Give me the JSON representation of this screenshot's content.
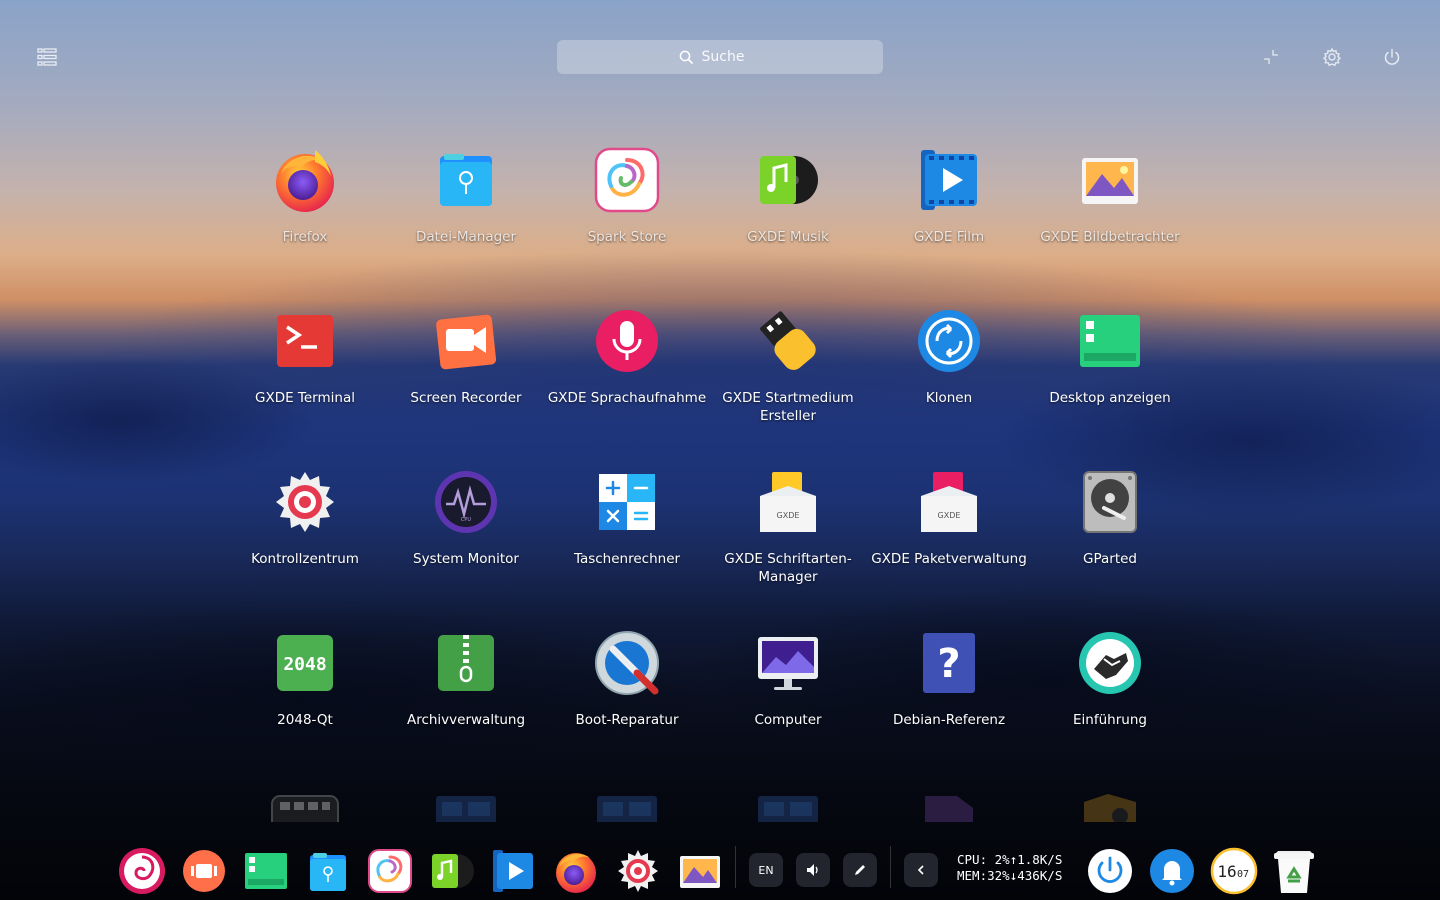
{
  "search": {
    "placeholder": "Suche"
  },
  "apps": [
    {
      "label": "Firefox"
    },
    {
      "label": "Datei-Manager"
    },
    {
      "label": "Spark Store"
    },
    {
      "label": "GXDE Musik"
    },
    {
      "label": "GXDE Film"
    },
    {
      "label": "GXDE Bildbetrachter"
    },
    {
      "label": "GXDE Terminal"
    },
    {
      "label": "Screen Recorder"
    },
    {
      "label": "GXDE Sprachaufnahme"
    },
    {
      "label": "GXDE Startmedium Ersteller"
    },
    {
      "label": "Klonen"
    },
    {
      "label": "Desktop anzeigen"
    },
    {
      "label": "Kontrollzentrum"
    },
    {
      "label": "System Monitor"
    },
    {
      "label": "Taschenrechner"
    },
    {
      "label": "GXDE Schriftarten-Manager"
    },
    {
      "label": "GXDE Paketverwaltung"
    },
    {
      "label": "GParted"
    },
    {
      "label": "2048-Qt"
    },
    {
      "label": "Archivverwaltung"
    },
    {
      "label": "Boot-Reparatur"
    },
    {
      "label": "Computer"
    },
    {
      "label": "Debian-Referenz"
    },
    {
      "label": "Einführung"
    }
  ],
  "icon_texts": {
    "game_2048": "2048",
    "fonts_logo": "GXDE",
    "pkg_logo": "GXDE",
    "debian_ref": "?",
    "cpu": "CPU"
  },
  "tray": {
    "keyboard_layout": "EN",
    "cpu_line": "CPU: 2%↑1.8K/S",
    "mem_line": "MEM:32%↓436K/S",
    "clock_hour": "16",
    "clock_minute": "07"
  }
}
